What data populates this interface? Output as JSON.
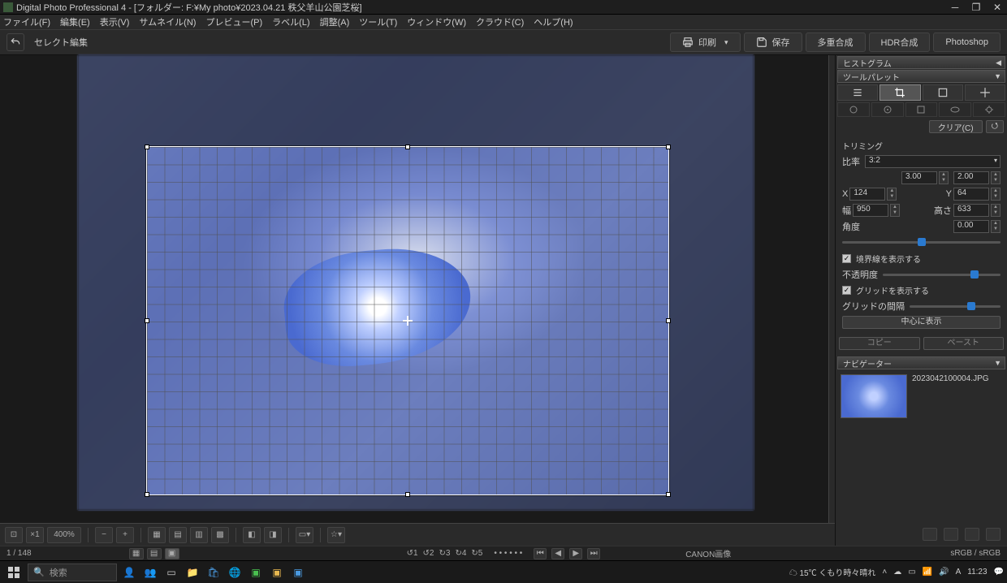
{
  "app": {
    "title": "Digital Photo Professional 4 - [フォルダー: F:¥My photo¥2023.04.21 秩父羊山公園芝桜]"
  },
  "menu": {
    "file": "ファイル(F)",
    "edit": "編集(E)",
    "view": "表示(V)",
    "thumbnail": "サムネイル(N)",
    "preview": "プレビュー(P)",
    "label": "ラベル(L)",
    "adjust": "調整(A)",
    "tool": "ツール(T)",
    "window": "ウィンドウ(W)",
    "cloud": "クラウド(C)",
    "help": "ヘルプ(H)"
  },
  "toolbar": {
    "select_edit": "セレクト編集",
    "print": "印刷",
    "save": "保存",
    "multi": "多重合成",
    "hdr": "HDR合成",
    "ps": "Photoshop"
  },
  "histogram": {
    "title": "ヒストグラム"
  },
  "palette": {
    "title": "ツールパレット",
    "clear": "クリア(C)",
    "trimming": "トリミング",
    "ratio_label": "比率",
    "ratio_value": "3:2",
    "ratio_w": "3.00",
    "ratio_h": "2.00",
    "x_label": "X",
    "x_value": "124",
    "y_label": "Y",
    "y_value": "64",
    "w_label": "幅",
    "w_value": "950",
    "h_label": "高さ",
    "h_value": "633",
    "angle_label": "角度",
    "angle_value": "0.00",
    "show_border": "境界線を表示する",
    "opacity": "不透明度",
    "show_grid": "グリッドを表示する",
    "grid_spacing": "グリッドの間隔",
    "center": "中心に表示",
    "copy": "コピー",
    "paste": "ペースト"
  },
  "navigator": {
    "title": "ナビゲーター",
    "filename": "2023042100004.JPG"
  },
  "bottom": {
    "zoom": "400%",
    "counter": "1 / 148",
    "rot1": "↺1",
    "rot2": "↺2",
    "rot3": "↻3",
    "rot4": "↻4",
    "rot5": "↻5",
    "canon": "CANON画像",
    "srgb": "sRGB / sRGB"
  },
  "taskbar": {
    "search": "検索",
    "weather": "15℃ くもり時々晴れ",
    "time": "11:23"
  }
}
